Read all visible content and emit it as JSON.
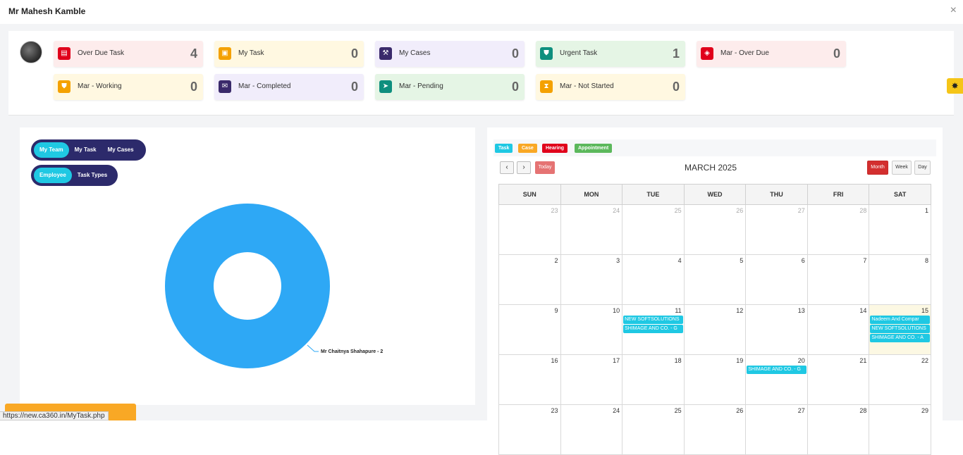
{
  "window": {
    "title": "Mr Mahesh Kamble",
    "close_glyph": "×"
  },
  "stats": [
    {
      "label": "Over Due Task",
      "value": "4",
      "icon": "task-icon",
      "glyph": "▤",
      "icon_color": "#e0001b",
      "bg": "#fdecec"
    },
    {
      "label": "My Task",
      "value": "0",
      "icon": "note-icon",
      "glyph": "▣",
      "icon_color": "#f4a100",
      "bg": "#fff8e1"
    },
    {
      "label": "My Cases",
      "value": "0",
      "icon": "gavel-icon",
      "glyph": "⚒",
      "icon_color": "#3a2a6b",
      "bg": "#f1edfb"
    },
    {
      "label": "Urgent Task",
      "value": "1",
      "icon": "shield-icon",
      "glyph": "⛊",
      "icon_color": "#0e8f7e",
      "bg": "#e5f5e5"
    },
    {
      "label": "Mar - Over Due",
      "value": "0",
      "icon": "diamond-icon",
      "glyph": "◈",
      "icon_color": "#e0001b",
      "bg": "#fdecec"
    },
    {
      "label": "Mar - Working",
      "value": "0",
      "icon": "shield-icon",
      "glyph": "⛊",
      "icon_color": "#f4a100",
      "bg": "#fff8e1"
    },
    {
      "label": "Mar - Completed",
      "value": "0",
      "icon": "envelope-icon",
      "glyph": "✉",
      "icon_color": "#3a2a6b",
      "bg": "#f1edfb"
    },
    {
      "label": "Mar - Pending",
      "value": "0",
      "icon": "send-icon",
      "glyph": "➤",
      "icon_color": "#0e8f7e",
      "bg": "#e5f5e5"
    },
    {
      "label": "Mar - Not Started",
      "value": "0",
      "icon": "hourglass-icon",
      "glyph": "⧗",
      "icon_color": "#f4a100",
      "bg": "#fff8e1"
    }
  ],
  "settings_glyph": "✸",
  "chart_filters": {
    "scope": [
      {
        "label": "My Team",
        "active": true
      },
      {
        "label": "My Task",
        "active": false
      },
      {
        "label": "My Cases",
        "active": false
      }
    ],
    "group": [
      {
        "label": "Employee",
        "active": true
      },
      {
        "label": "Task Types",
        "active": false
      }
    ]
  },
  "chart_data": {
    "type": "pie",
    "donut": true,
    "slices": [
      {
        "label": "Mr Chaitnya Shahapure - 2",
        "value": 2,
        "color": "#2ea8f5"
      }
    ]
  },
  "status_url": "https://new.ca360.in/MyTask.php",
  "calendar": {
    "legend": [
      {
        "label": "Task",
        "color": "#1fc8e3"
      },
      {
        "label": "Case",
        "color": "#f9a825"
      },
      {
        "label": "Hearing",
        "color": "#e0001b"
      },
      {
        "label": "Appointment",
        "color": "#5cb85c"
      }
    ],
    "prev": "‹",
    "next": "›",
    "today_label": "Today",
    "title": "MARCH 2025",
    "views": [
      {
        "label": "Month",
        "active": true
      },
      {
        "label": "Week",
        "active": false
      },
      {
        "label": "Day",
        "active": false
      }
    ],
    "days": [
      "SUN",
      "MON",
      "TUE",
      "WED",
      "THU",
      "FRI",
      "SAT"
    ],
    "weeks": [
      [
        {
          "d": "23",
          "other": true
        },
        {
          "d": "24",
          "other": true
        },
        {
          "d": "25",
          "other": true
        },
        {
          "d": "26",
          "other": true
        },
        {
          "d": "27",
          "other": true
        },
        {
          "d": "28",
          "other": true
        },
        {
          "d": "1"
        }
      ],
      [
        {
          "d": "2"
        },
        {
          "d": "3"
        },
        {
          "d": "4"
        },
        {
          "d": "5"
        },
        {
          "d": "6"
        },
        {
          "d": "7"
        },
        {
          "d": "8"
        }
      ],
      [
        {
          "d": "9"
        },
        {
          "d": "10"
        },
        {
          "d": "11",
          "events": [
            "NEW SOFTSOLUTIONS",
            "SHIMAGE AND CO. - G"
          ]
        },
        {
          "d": "12"
        },
        {
          "d": "13"
        },
        {
          "d": "14"
        },
        {
          "d": "15",
          "today": true,
          "events": [
            "Nadeem And Compar",
            "NEW SOFTSOLUTIONS",
            "SHIMAGE AND CO. - A"
          ]
        }
      ],
      [
        {
          "d": "16"
        },
        {
          "d": "17"
        },
        {
          "d": "18"
        },
        {
          "d": "19"
        },
        {
          "d": "20",
          "events": [
            "SHIMAGE AND CO. - G"
          ]
        },
        {
          "d": "21"
        },
        {
          "d": "22"
        }
      ],
      [
        {
          "d": "23"
        },
        {
          "d": "24"
        },
        {
          "d": "25"
        },
        {
          "d": "26"
        },
        {
          "d": "27"
        },
        {
          "d": "28"
        },
        {
          "d": "29"
        }
      ]
    ]
  }
}
